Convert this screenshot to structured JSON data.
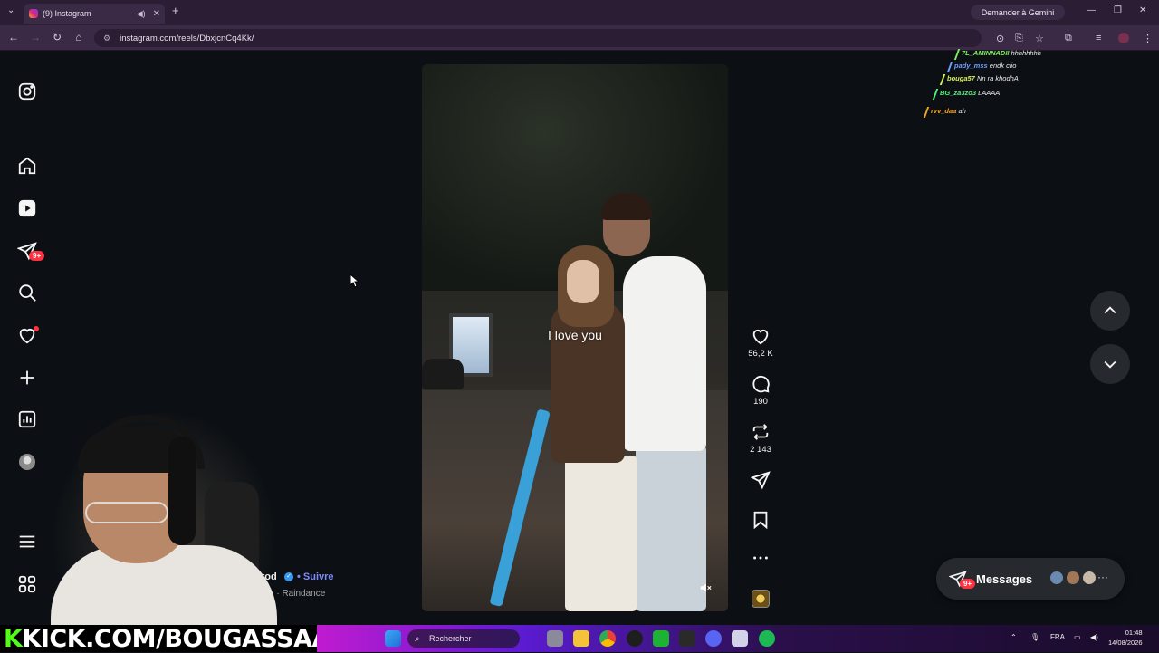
{
  "browser": {
    "tab_title": "(9) Instagram",
    "url": "instagram.com/reels/DbxjcnCq4Kk/",
    "gemini_button": "Demander à Gemini"
  },
  "reel": {
    "caption": "I love you",
    "author": "rod",
    "follow_label": "• Suivre",
    "audio": "ns · Raindance"
  },
  "actions": {
    "likes": "56,2 K",
    "comments": "190",
    "reposts": "2 143"
  },
  "nav": {
    "dm_badge": "9+"
  },
  "messages": {
    "label": "Messages",
    "badge": "9+",
    "more": "···"
  },
  "chat": [
    {
      "user": "7L_AMINNADII",
      "text": "hhhhhhhh",
      "color": "#7cf05a"
    },
    {
      "user": "pady_mss",
      "text": "endk ciio",
      "color": "#6fa0ff"
    },
    {
      "user": "bouga57",
      "text": "Nn ra khodhA",
      "color": "#d8f25a"
    },
    {
      "user": "BG_za3zo3",
      "text": "LAAAA",
      "color": "#5af07c"
    },
    {
      "user": "rvv_daa",
      "text": "ah",
      "color": "#f5a623"
    }
  ],
  "stream": {
    "banner_prefix": "K",
    "banner_text": "KICK.COM/BOUGASSAA"
  },
  "taskbar": {
    "search_label": "Rechercher",
    "language": "FRA",
    "time": "01:48",
    "date": "14/08/2026"
  },
  "colors": {
    "accent_link": "#7d8df7",
    "notification": "#ff3040",
    "kick_green": "#53fc18",
    "background": "#0c1014"
  }
}
